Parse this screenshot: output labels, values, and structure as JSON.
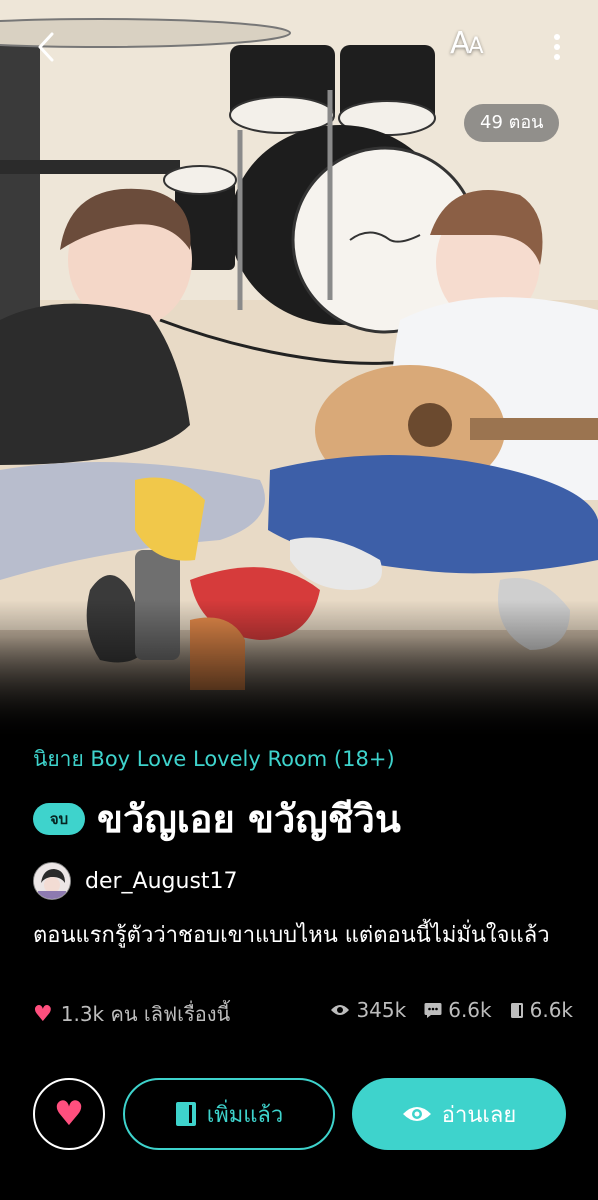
{
  "header": {
    "font_size_label": "A",
    "font_size_label_small": "A",
    "episode_count": "49 ตอน"
  },
  "novel": {
    "category": "นิยาย Boy Love Lovely Room  (18+)",
    "status_badge": "จบ",
    "title": "ขวัญเอย ขวัญชีวิน",
    "author": "der_August17",
    "description": "ตอนแรกรู้ตัวว่าชอบเขาแบบไหน แต่ตอนนี้ไม่มั่นใจแล้ว",
    "likes_text": "1.3k คน เลิฟเรื่องนี้",
    "views": "345k",
    "comments": "6.6k",
    "library_adds": "6.6k"
  },
  "actions": {
    "library_label": "เพิ่มแล้ว",
    "read_label": "อ่านเลย"
  },
  "colors": {
    "accent": "#3ed3cc",
    "heart": "#ff4f7e",
    "background": "#000000"
  },
  "icons": [
    "back-arrow-icon",
    "font-size-icon",
    "more-vert-icon",
    "heart-icon",
    "eye-icon",
    "comment-icon",
    "book-icon"
  ]
}
